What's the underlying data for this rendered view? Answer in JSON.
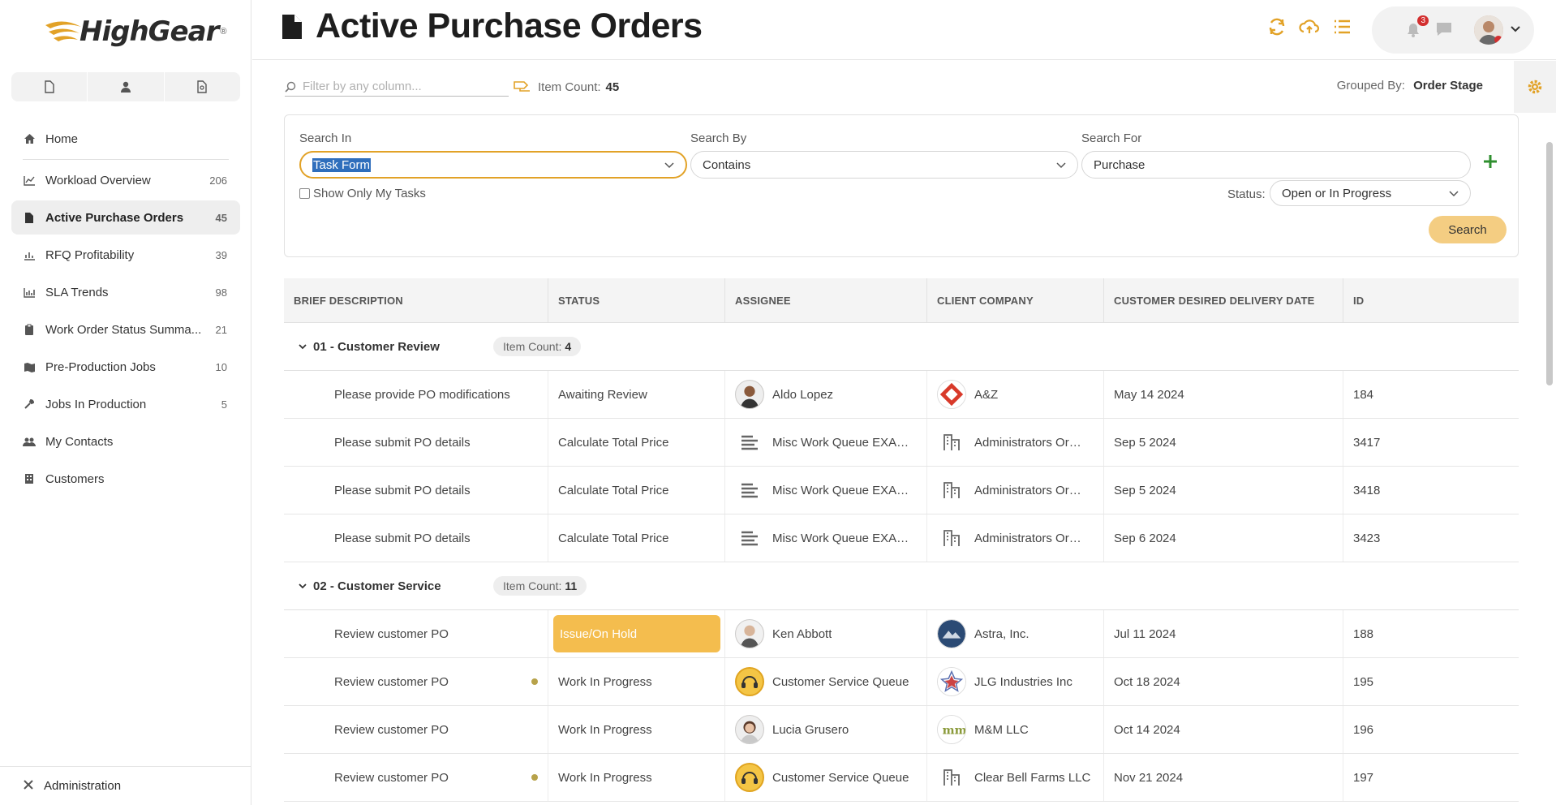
{
  "app": {
    "logo_text": "HighGear",
    "logo_reg": "®"
  },
  "sidebar": {
    "items": [
      {
        "label": "Home",
        "count": "",
        "icon": "home-icon"
      },
      {
        "label": "Workload Overview",
        "count": "206",
        "icon": "chart-line-icon"
      },
      {
        "label": "Active Purchase Orders",
        "count": "45",
        "icon": "document-icon"
      },
      {
        "label": "RFQ Profitability",
        "count": "39",
        "icon": "chart-gauge-icon"
      },
      {
        "label": "SLA Trends",
        "count": "98",
        "icon": "bar-chart-icon"
      },
      {
        "label": "Work Order Status Summa...",
        "count": "21",
        "icon": "clipboard-icon"
      },
      {
        "label": "Pre-Production Jobs",
        "count": "10",
        "icon": "map-icon"
      },
      {
        "label": "Jobs In Production",
        "count": "5",
        "icon": "wrench-icon"
      },
      {
        "label": "My Contacts",
        "count": "",
        "icon": "users-icon"
      },
      {
        "label": "Customers",
        "count": "",
        "icon": "building-icon"
      }
    ],
    "admin_label": "Administration"
  },
  "header": {
    "title": "Active Purchase Orders",
    "notification_count": "3"
  },
  "toolbar": {
    "filter_placeholder": "Filter by any column...",
    "item_count_label": "Item Count:",
    "item_count": "45",
    "grouped_by_label": "Grouped By:",
    "grouped_by_value": "Order Stage"
  },
  "search": {
    "search_in_label": "Search In",
    "search_in_value": "Task Form",
    "search_by_label": "Search By",
    "search_by_value": "Contains",
    "search_for_label": "Search For",
    "search_for_value": "Purchase",
    "show_only_mine_label": "Show Only My Tasks",
    "status_label": "Status:",
    "status_value": "Open or In Progress",
    "search_button": "Search"
  },
  "grid": {
    "columns": [
      "BRIEF DESCRIPTION",
      "STATUS",
      "ASSIGNEE",
      "CLIENT COMPANY",
      "CUSTOMER DESIRED DELIVERY DATE",
      "ID"
    ],
    "groups": [
      {
        "name": "01 - Customer Review",
        "count_label": "Item Count:",
        "count": "4",
        "rows": [
          {
            "desc": "Please provide PO modifications",
            "status": "Awaiting Review",
            "assignee": "Aldo Lopez",
            "company": "A&Z",
            "date": "May 14 2024",
            "id": "184"
          },
          {
            "desc": "Please submit PO details",
            "status": "Calculate Total Price",
            "assignee": "Misc Work Queue EXAMPLE",
            "company": "Administrators Organization",
            "date": "Sep 5 2024",
            "id": "3417"
          },
          {
            "desc": "Please submit PO details",
            "status": "Calculate Total Price",
            "assignee": "Misc Work Queue EXAMPLE",
            "company": "Administrators Organization",
            "date": "Sep 5 2024",
            "id": "3418"
          },
          {
            "desc": "Please submit PO details",
            "status": "Calculate Total Price",
            "assignee": "Misc Work Queue EXAMPLE",
            "company": "Administrators Organization",
            "date": "Sep 6 2024",
            "id": "3423"
          }
        ]
      },
      {
        "name": "02 - Customer Service",
        "count_label": "Item Count:",
        "count": "11",
        "rows": [
          {
            "desc": "Review customer PO",
            "status": "Issue/On Hold",
            "assignee": "Ken Abbott",
            "company": "Astra, Inc.",
            "date": "Jul 11 2024",
            "id": "188"
          },
          {
            "desc": "Review customer PO",
            "status": "Work In Progress",
            "assignee": "Customer Service Queue",
            "company": "JLG Industries Inc",
            "date": "Oct 18 2024",
            "id": "195"
          },
          {
            "desc": "Review customer PO",
            "status": "Work In Progress",
            "assignee": "Lucia Grusero",
            "company": "M&M LLC",
            "date": "Oct 14 2024",
            "id": "196"
          },
          {
            "desc": "Review customer PO",
            "status": "Work In Progress",
            "assignee": "Customer Service Queue",
            "company": "Clear Bell Farms LLC",
            "date": "Nov 21 2024",
            "id": "197"
          }
        ]
      }
    ]
  },
  "colors": {
    "accent": "#e2a227",
    "hold": "#f4bd4e",
    "search_button": "#f4cd82",
    "add": "#2f8f2f"
  }
}
